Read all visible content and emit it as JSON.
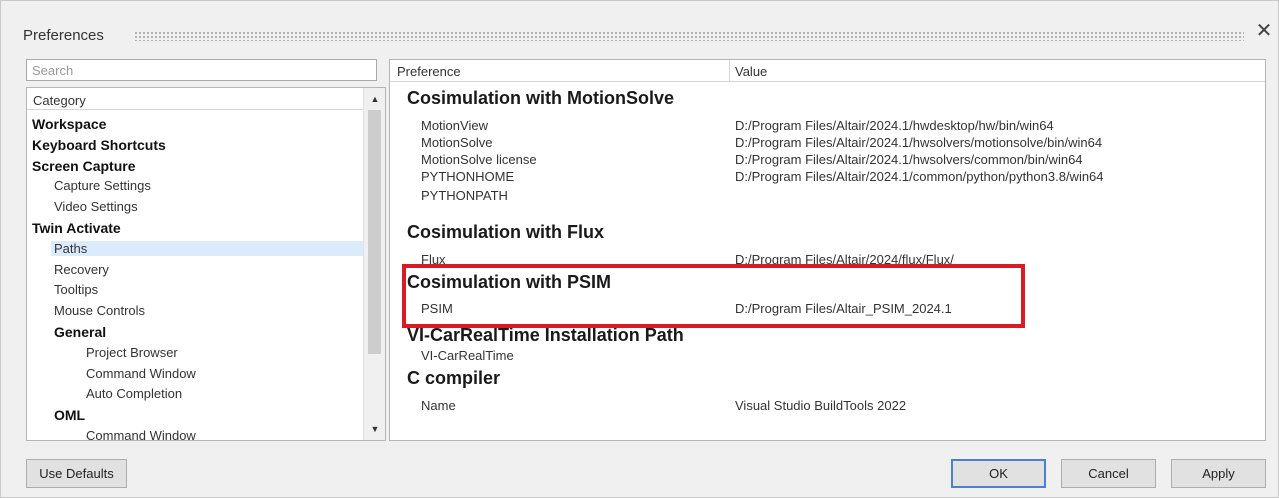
{
  "window": {
    "title": "Preferences",
    "close_glyph": "✕"
  },
  "search": {
    "placeholder": "Search",
    "value": ""
  },
  "category": {
    "header": "Category",
    "items": [
      {
        "label": "Workspace",
        "bold": true,
        "level": 0
      },
      {
        "label": "Keyboard Shortcuts",
        "bold": true,
        "level": 0
      },
      {
        "label": "Screen Capture",
        "bold": true,
        "level": 0
      },
      {
        "label": "Capture Settings",
        "bold": false,
        "level": 1
      },
      {
        "label": "Video Settings",
        "bold": false,
        "level": 1
      },
      {
        "label": "Twin Activate",
        "bold": true,
        "level": 0
      },
      {
        "label": "Paths",
        "bold": false,
        "level": 1,
        "selected": true
      },
      {
        "label": "Recovery",
        "bold": false,
        "level": 1
      },
      {
        "label": "Tooltips",
        "bold": false,
        "level": 1
      },
      {
        "label": "Mouse Controls",
        "bold": false,
        "level": 1
      },
      {
        "label": "General",
        "bold": true,
        "level": 1
      },
      {
        "label": "Project Browser",
        "bold": false,
        "level": 2
      },
      {
        "label": "Command Window",
        "bold": false,
        "level": 2
      },
      {
        "label": "Auto Completion",
        "bold": false,
        "level": 2
      },
      {
        "label": "OML",
        "bold": true,
        "level": 1
      },
      {
        "label": "Command Window",
        "bold": false,
        "level": 2
      }
    ],
    "scroll_up_glyph": "▲",
    "scroll_down_glyph": "▼"
  },
  "preferences": {
    "col_preference": "Preference",
    "col_value": "Value",
    "sections": [
      {
        "title": "Cosimulation with MotionSolve",
        "rows": [
          {
            "name": "MotionView",
            "value": "D:/Program Files/Altair/2024.1/hwdesktop/hw/bin/win64"
          },
          {
            "name": "MotionSolve",
            "value": "D:/Program Files/Altair/2024.1/hwsolvers/motionsolve/bin/win64"
          },
          {
            "name": "MotionSolve license",
            "value": "D:/Program Files/Altair/2024.1/hwsolvers/common/bin/win64"
          },
          {
            "name": "PYTHONHOME",
            "value": "D:/Program Files/Altair/2024.1/common/python/python3.8/win64"
          },
          {
            "name": "PYTHONPATH",
            "value": ""
          }
        ]
      },
      {
        "title": "Cosimulation with Flux",
        "rows": [
          {
            "name": "Flux",
            "value": "D:/Program Files/Altair/2024/flux/Flux/"
          }
        ]
      },
      {
        "title": "Cosimulation with PSIM",
        "rows": [
          {
            "name": "PSIM",
            "value": "D:/Program Files/Altair_PSIM_2024.1"
          }
        ]
      },
      {
        "title": "VI-CarRealTime Installation Path",
        "rows": [
          {
            "name": "VI-CarRealTime",
            "value": ""
          }
        ]
      },
      {
        "title": "C compiler",
        "rows": [
          {
            "name": "Name",
            "value": "Visual Studio BuildTools 2022"
          }
        ]
      }
    ],
    "highlight_color": "#d91c23"
  },
  "buttons": {
    "use_defaults": "Use Defaults",
    "ok": "OK",
    "cancel": "Cancel",
    "apply": "Apply"
  }
}
